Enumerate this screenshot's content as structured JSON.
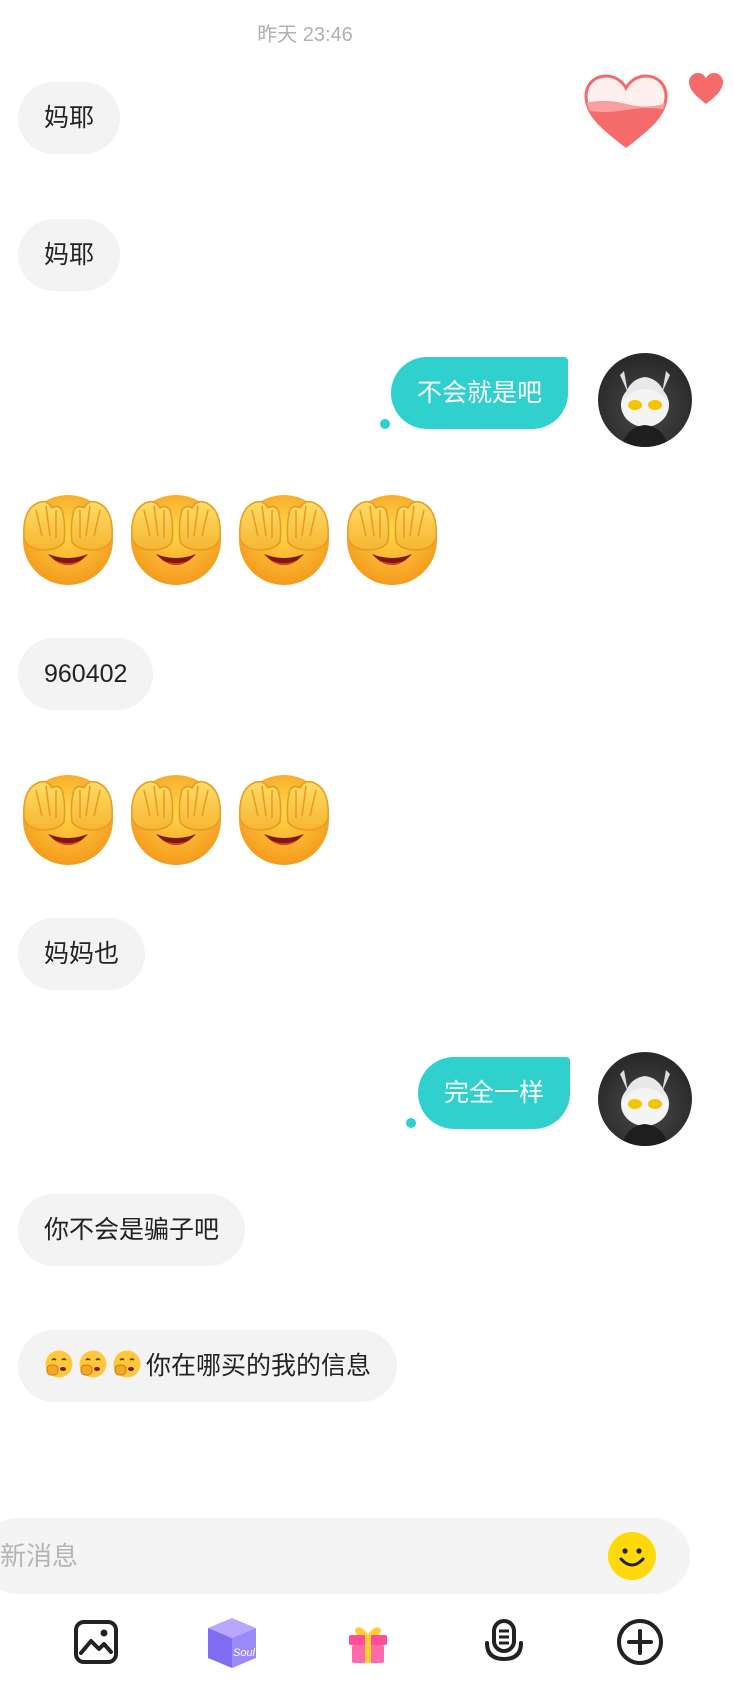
{
  "timestamp": "昨天 23:46",
  "messages": [
    {
      "type": "text",
      "from": "other",
      "text": "妈耶"
    },
    {
      "type": "text",
      "from": "other",
      "text": "妈耶"
    },
    {
      "type": "text",
      "from": "self",
      "text": "不会就是吧"
    },
    {
      "type": "emoji",
      "from": "other",
      "emoji": "see-no-evil-face",
      "count": 4
    },
    {
      "type": "text",
      "from": "other",
      "text": "960402"
    },
    {
      "type": "emoji",
      "from": "other",
      "emoji": "see-no-evil-face",
      "count": 3
    },
    {
      "type": "text",
      "from": "other",
      "text": "妈妈也"
    },
    {
      "type": "text",
      "from": "self",
      "text": "完全一样"
    },
    {
      "type": "text",
      "from": "other",
      "text": "你不会是骗子吧"
    },
    {
      "type": "text",
      "from": "other",
      "prefix_emoji": "shushing-face",
      "prefix_count": 3,
      "text": "你在哪买的我的信息"
    }
  ],
  "input": {
    "placeholder": "新消息"
  },
  "toolbar": {
    "items": [
      {
        "icon": "image-icon"
      },
      {
        "icon": "soul-box-icon",
        "label": "Soul"
      },
      {
        "icon": "gift-icon"
      },
      {
        "icon": "voice-icon"
      },
      {
        "icon": "plus-circle-icon"
      }
    ]
  },
  "colors": {
    "accent": "#2fd0cd",
    "bubble_in": "#f3f3f3",
    "heart": "#f56b6b"
  }
}
